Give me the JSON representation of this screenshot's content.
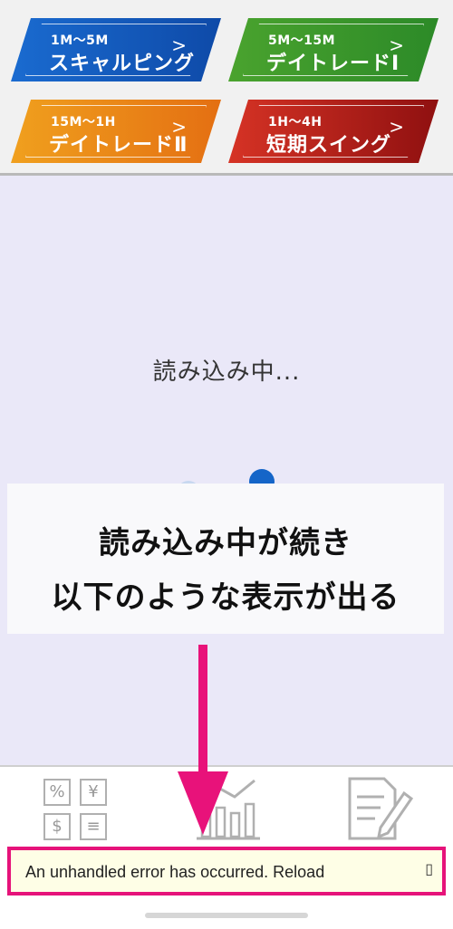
{
  "modes": [
    {
      "range": "1M〜5M",
      "name": "スキャルピング",
      "color": "#1a6bd0"
    },
    {
      "range": "5M〜15M",
      "name": "デイトレードⅠ",
      "color": "#3e9a2c"
    },
    {
      "range": "15M〜1H",
      "name": "デイトレードⅡ",
      "color": "#ea8a18"
    },
    {
      "range": "1H〜4H",
      "name": "短期スイング",
      "color": "#c02a1e"
    }
  ],
  "chevron": ">",
  "loading": {
    "text": "読み込み中..."
  },
  "overlay": {
    "line1": "読み込み中が続き",
    "line2": "以下のような表示が出る"
  },
  "tabs": {
    "fx": {
      "cells": [
        "%",
        "¥",
        "$",
        "≡"
      ]
    },
    "chart": {
      "icon": "chart-icon"
    },
    "note": {
      "icon": "note-icon"
    }
  },
  "error": {
    "message": "An unhandled error has occurred. Reload",
    "dismiss": "▯"
  },
  "colors": {
    "highlight": "#e6137a",
    "arrow": "#e8127a",
    "error_bg": "#fefee6"
  }
}
